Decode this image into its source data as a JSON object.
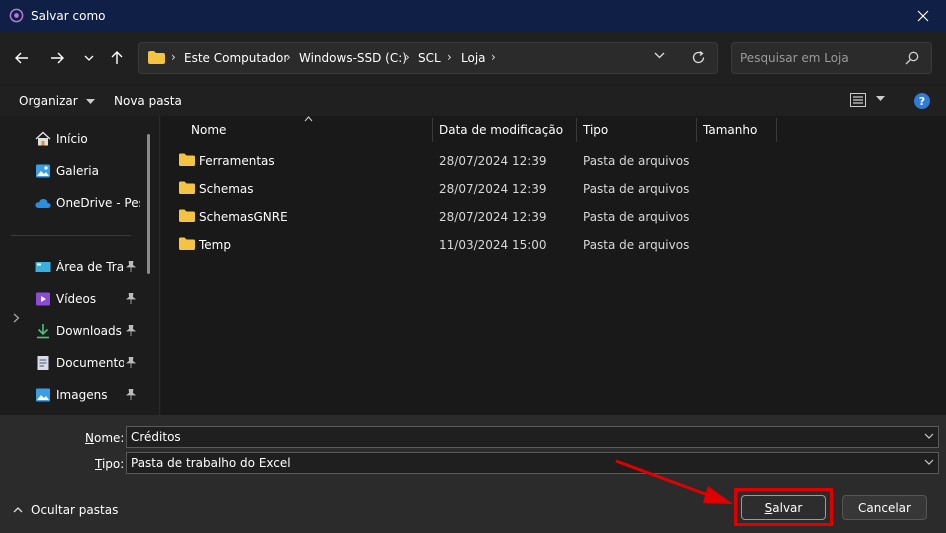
{
  "window": {
    "title": "Salvar como"
  },
  "address": {
    "crumbs": [
      "Este Computador",
      "Windows-SSD (C:)",
      "SCL",
      "Loja"
    ]
  },
  "search": {
    "placeholder": "Pesquisar em Loja"
  },
  "toolbar": {
    "organize": "Organizar",
    "new_folder": "Nova pasta",
    "help": "?"
  },
  "sidebar": {
    "items": [
      {
        "label": "Início",
        "icon": "home-icon"
      },
      {
        "label": "Galeria",
        "icon": "gallery-icon"
      },
      {
        "label": "OneDrive - Pessoal",
        "icon": "cloud-icon"
      },
      {
        "label": "Área de Trabalho",
        "icon": "desktop-icon"
      },
      {
        "label": "Vídeos",
        "icon": "video-icon"
      },
      {
        "label": "Downloads",
        "icon": "download-icon"
      },
      {
        "label": "Documentos",
        "icon": "document-icon"
      },
      {
        "label": "Imagens",
        "icon": "image-icon"
      }
    ]
  },
  "columns": {
    "name": "Nome",
    "modified": "Data de modificação",
    "type": "Tipo",
    "size": "Tamanho"
  },
  "files": [
    {
      "name": "Ferramentas",
      "modified": "28/07/2024 12:39",
      "type": "Pasta de arquivos"
    },
    {
      "name": "Schemas",
      "modified": "28/07/2024 12:39",
      "type": "Pasta de arquivos"
    },
    {
      "name": "SchemasGNRE",
      "modified": "28/07/2024 12:39",
      "type": "Pasta de arquivos"
    },
    {
      "name": "Temp",
      "modified": "11/03/2024 15:00",
      "type": "Pasta de arquivos"
    }
  ],
  "form": {
    "name_label_u": "N",
    "name_label_rest": "ome:",
    "name_value": "Créditos",
    "type_label_u": "T",
    "type_label_rest": "ipo:",
    "type_value": "Pasta de trabalho do Excel"
  },
  "footer": {
    "hide_folders": "Ocultar pastas",
    "save_u": "S",
    "save_rest": "alvar",
    "cancel": "Cancelar"
  },
  "colors": {
    "titlebar": "#0f1f45",
    "folder": "#f5c342",
    "highlight": "#e00000",
    "accent": "#2f7bd6"
  }
}
